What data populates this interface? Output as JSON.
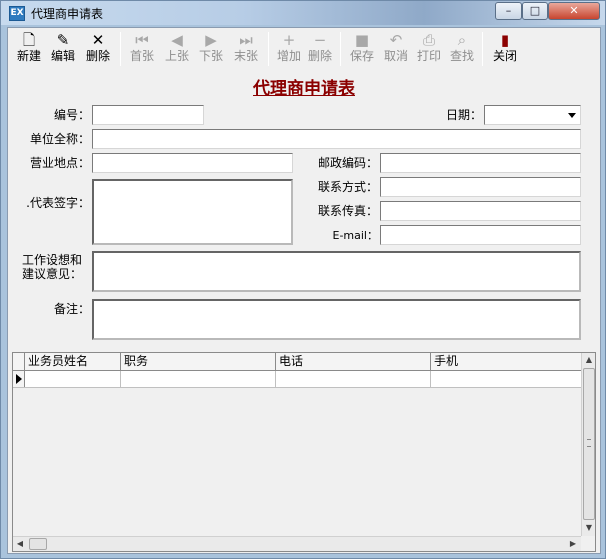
{
  "window": {
    "title": "代理商申请表",
    "app_icon_text": "EX",
    "controls": {
      "minimize": "–",
      "maximize": "□",
      "close": "✕"
    }
  },
  "toolbar": {
    "new": {
      "label": "新建",
      "icon": "new-document-icon",
      "glyph": "🗋"
    },
    "edit": {
      "label": "编辑",
      "icon": "edit-icon",
      "glyph": "✎"
    },
    "delete": {
      "label": "删除",
      "icon": "delete-x-icon",
      "glyph": "✕"
    },
    "first": {
      "label": "首张",
      "icon": "first-record-icon",
      "glyph": "⏮"
    },
    "prev": {
      "label": "上张",
      "icon": "previous-record-icon",
      "glyph": "◀"
    },
    "next": {
      "label": "下张",
      "icon": "next-record-icon",
      "glyph": "▶"
    },
    "last": {
      "label": "末张",
      "icon": "last-record-icon",
      "glyph": "⏭"
    },
    "add": {
      "label": "增加",
      "icon": "add-row-icon",
      "glyph": "+"
    },
    "remove": {
      "label": "删除",
      "icon": "remove-row-icon",
      "glyph": "−"
    },
    "save": {
      "label": "保存",
      "icon": "save-icon",
      "glyph": "■"
    },
    "cancel": {
      "label": "取消",
      "icon": "undo-icon",
      "glyph": "↶"
    },
    "print": {
      "label": "打印",
      "icon": "printer-icon",
      "glyph": "⎙"
    },
    "find": {
      "label": "查找",
      "icon": "search-icon",
      "glyph": "⌕"
    },
    "close": {
      "label": "关闭",
      "icon": "exit-door-icon",
      "glyph": "▮"
    }
  },
  "form": {
    "title": "代理商申请表",
    "fields": {
      "number": {
        "label": "编号：",
        "value": ""
      },
      "date": {
        "label": "日期：",
        "value": ""
      },
      "company_name": {
        "label": "单位全称：",
        "value": ""
      },
      "business_location": {
        "label": "营业地点：",
        "value": ""
      },
      "postal_code": {
        "label": "邮政编码：",
        "value": ""
      },
      "representative_signature": {
        "label": ".代表签字：",
        "value": ""
      },
      "contact_method": {
        "label": "联系方式：",
        "value": ""
      },
      "fax": {
        "label": "联系传真：",
        "value": ""
      },
      "email": {
        "label": "E-mail：",
        "value": ""
      },
      "work_plan_line1": {
        "label": "工作设想和"
      },
      "work_plan_line2": {
        "label": "建议意见："
      },
      "remarks": {
        "label": "备注：",
        "value": ""
      }
    }
  },
  "grid": {
    "columns": [
      "业务员姓名",
      "职务",
      "电话",
      "手机"
    ],
    "rows": [
      [
        "",
        "",
        "",
        ""
      ]
    ]
  }
}
